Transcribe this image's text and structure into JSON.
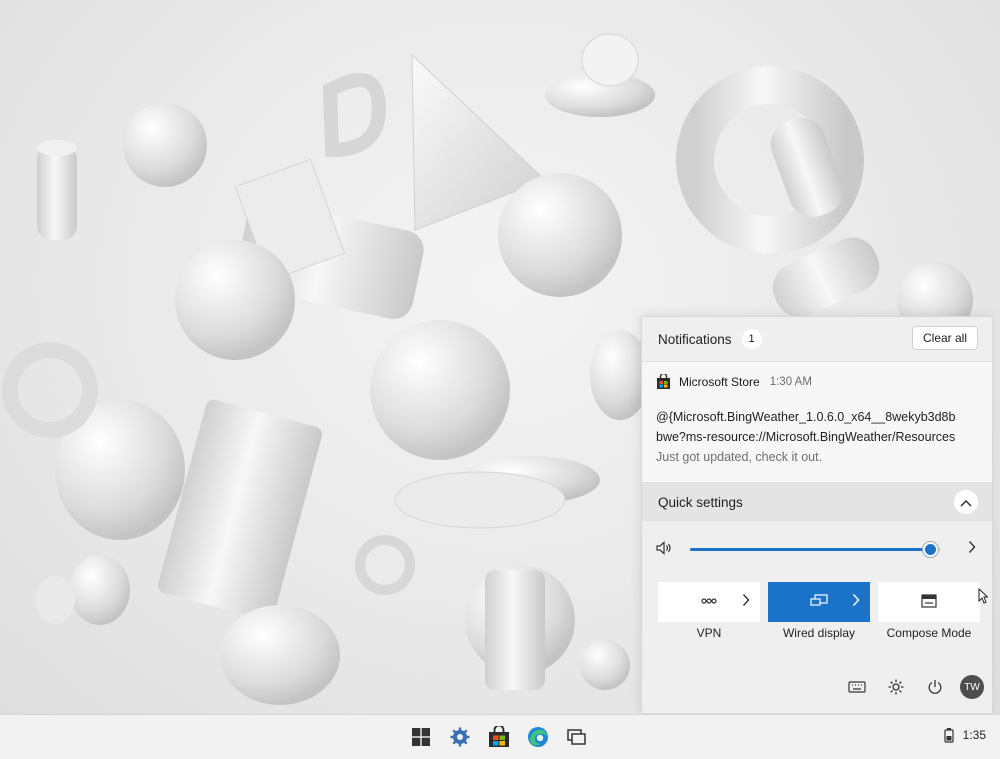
{
  "notifications": {
    "title": "Notifications",
    "count": "1",
    "clear_all_label": "Clear all",
    "items": [
      {
        "app": "Microsoft Store",
        "time": "1:30 AM",
        "body_line1": "@{Microsoft.BingWeather_1.0.6.0_x64__8wekyb3d8b",
        "body_line2": "bwe?ms-resource://Microsoft.BingWeather/Resources",
        "body_sub": "Just got updated, check it out."
      }
    ]
  },
  "quick_settings": {
    "title": "Quick settings",
    "volume_level": 0.96,
    "accent_color": "#1a73c9",
    "tiles": [
      {
        "label": "VPN",
        "icon": "vpn-icon",
        "active": false,
        "has_chevron": true
      },
      {
        "label": "Wired display",
        "icon": "wired-display-icon",
        "active": true,
        "has_chevron": true
      },
      {
        "label": "Compose Mode",
        "icon": "compose-mode-icon",
        "active": false,
        "has_chevron": false
      }
    ],
    "footer": {
      "icons": [
        "keyboard-icon",
        "settings-gear-icon",
        "power-icon"
      ],
      "avatar_initials": "TW"
    }
  },
  "taskbar": {
    "icons": [
      "windows-start-icon",
      "settings-gear-icon",
      "microsoft-store-icon",
      "edge-browser-icon",
      "task-view-icon"
    ],
    "tray_icon": "battery-icon",
    "clock": "1:35"
  }
}
